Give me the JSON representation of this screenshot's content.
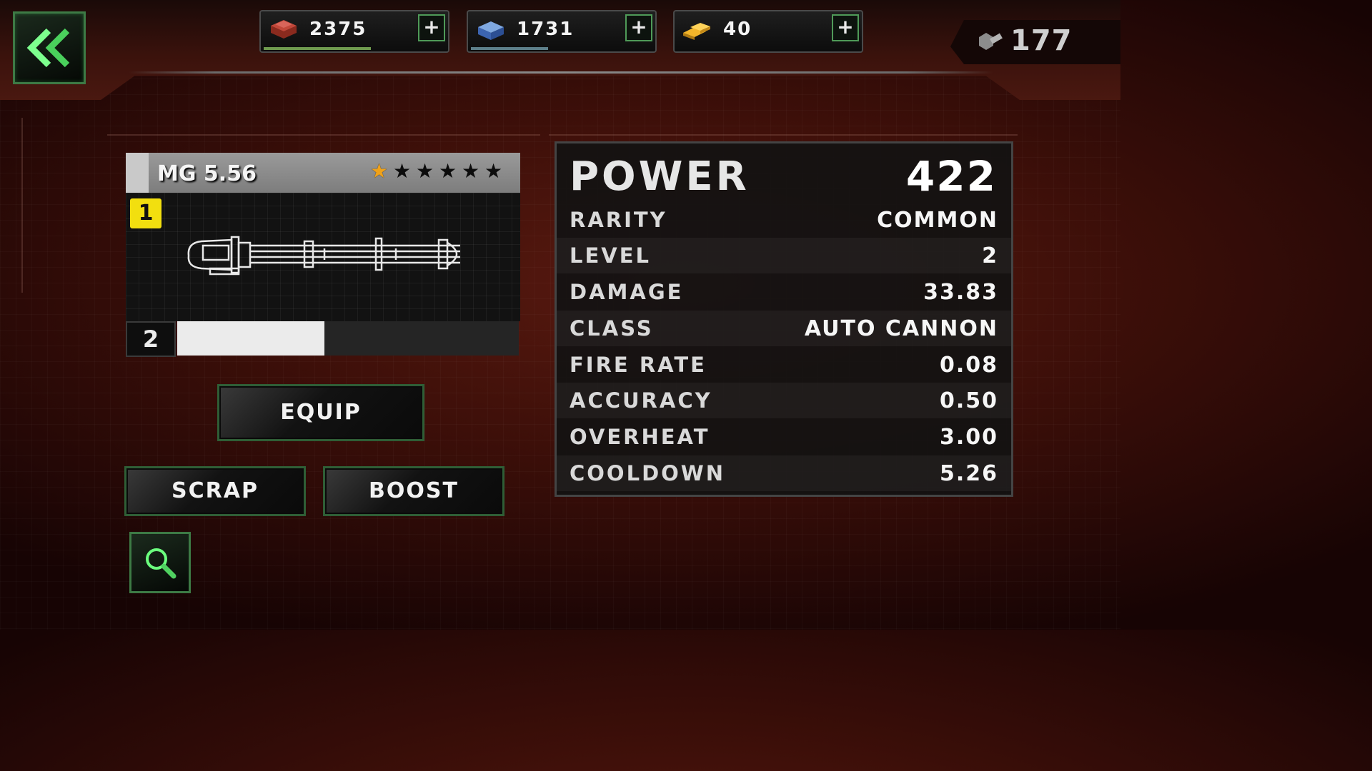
{
  "currencies": [
    {
      "amount": "2375",
      "icon": "steel-ingot-icon",
      "bar_fill": 0.6,
      "bar_color": "#6e9a4e"
    },
    {
      "amount": "1731",
      "icon": "blue-crate-icon",
      "bar_fill": 0.43,
      "bar_color": "#5d7f8a"
    },
    {
      "amount": "40",
      "icon": "gold-bars-icon",
      "bar_fill": 0,
      "bar_color": "#8a7a3a"
    }
  ],
  "bolts": {
    "amount": "177",
    "icon": "bolt-icon"
  },
  "weapon": {
    "name": "MG 5.56",
    "tier": "1",
    "stars_total": 6,
    "stars_filled": 1,
    "level": "2",
    "xp_fill": 0.43
  },
  "buttons": {
    "equip": "EQUIP",
    "scrap": "SCRAP",
    "boost": "BOOST"
  },
  "stats": {
    "power_label": "POWER",
    "power_value": "422",
    "rows": [
      {
        "label": "RARITY",
        "value": "COMMON"
      },
      {
        "label": "LEVEL",
        "value": "2"
      },
      {
        "label": "DAMAGE",
        "value": "33.83"
      },
      {
        "label": "CLASS",
        "value": "AUTO CANNON"
      },
      {
        "label": "FIRE RATE",
        "value": "0.08"
      },
      {
        "label": "ACCURACY",
        "value": "0.50"
      },
      {
        "label": "OVERHEAT",
        "value": "3.00"
      },
      {
        "label": "COOLDOWN",
        "value": "5.26"
      }
    ]
  },
  "colors": {
    "accent_green": "#3d7a45",
    "star_gold": "#f0a21a",
    "tier_yellow": "#f2df0f"
  }
}
